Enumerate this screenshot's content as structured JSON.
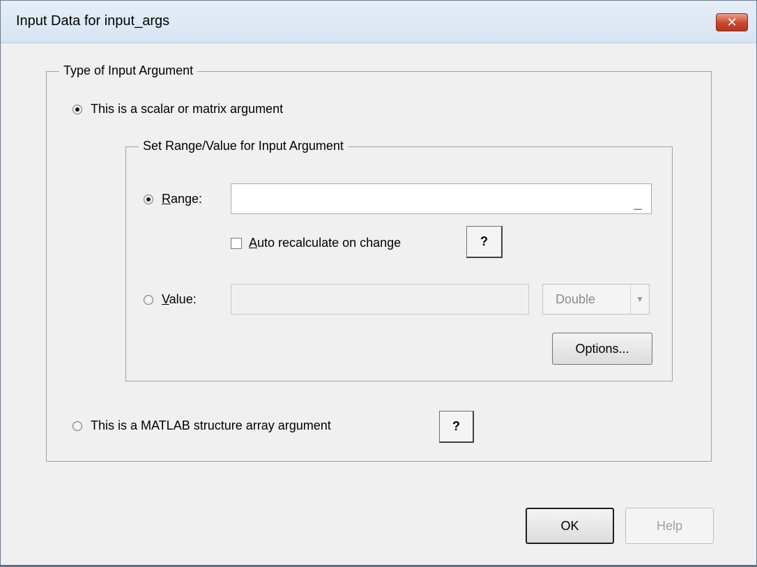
{
  "window": {
    "title": "Input Data for input_args",
    "close_glyph": "✕"
  },
  "type_group": {
    "legend": "Type of Input Argument",
    "scalar_option": {
      "label": "This is a scalar or matrix argument",
      "checked": true
    },
    "struct_option": {
      "label": "This is a MATLAB structure array argument",
      "checked": false
    },
    "struct_help_label": "?"
  },
  "range_group": {
    "legend": "Set Range/Value for Input Argument",
    "range_option": {
      "label_accel": "R",
      "label_rest": "ange:",
      "checked": true,
      "value": ""
    },
    "range_browse_label": "_",
    "auto_recalc": {
      "label_accel": "A",
      "label_rest": "uto recalculate on change",
      "checked": false
    },
    "auto_help_label": "?",
    "value_option": {
      "label_accel": "V",
      "label_rest": "alue:",
      "checked": false,
      "value": ""
    },
    "value_type": {
      "selected": "Double",
      "arrow_icon": "chevron-down-icon"
    },
    "options_button": "Options..."
  },
  "buttons": {
    "ok": "OK",
    "help": "Help"
  }
}
